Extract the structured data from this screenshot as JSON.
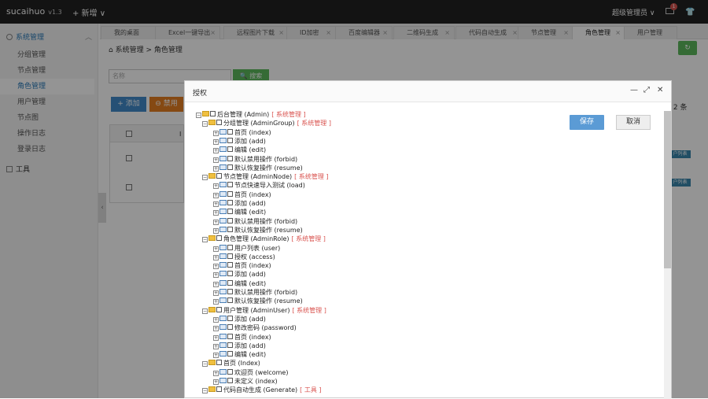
{
  "header": {
    "brand": "sucaihuo",
    "version": "v1.3",
    "new_label": "+ 新增 ∨",
    "admin_label": "超级管理员 ∨",
    "mail_count": "1"
  },
  "sidebar": {
    "group1": "系统管理",
    "items": [
      "分组管理",
      "节点管理",
      "角色管理",
      "用户管理",
      "节点图",
      "操作日志",
      "登录日志"
    ],
    "group2": "工具"
  },
  "tabs": [
    "我的桌面",
    "Excel一键导出",
    "远程图片下载",
    "ID加密",
    "百度编辑器",
    "二维码生成",
    "代码自动生成",
    "节点管理",
    "角色管理",
    "用户管理"
  ],
  "breadcrumb": {
    "root": "系统管理",
    "sep": ">",
    "current": "角色管理"
  },
  "toolbar": {
    "search_placeholder": "名称",
    "search_label": "搜索",
    "add_label": "+ 添加",
    "disable_label": "⊖ 禁用",
    "count_text": ": 2 条"
  },
  "table": {
    "col_id": "I",
    "row_labels": [
      "户列表",
      "户列表"
    ]
  },
  "modal": {
    "title": "授权",
    "save_label": "保存",
    "cancel_label": "取消"
  },
  "tree": [
    {
      "l": 0,
      "t": "f",
      "text": "后台管理 (Admin)",
      "tag": "[ 系统管理 ]"
    },
    {
      "l": 1,
      "t": "f",
      "text": "分组管理 (AdminGroup)",
      "tag": "[ 系统管理 ]"
    },
    {
      "l": 2,
      "t": "p",
      "text": "首页 (index)"
    },
    {
      "l": 2,
      "t": "p",
      "text": "添加 (add)"
    },
    {
      "l": 2,
      "t": "p",
      "text": "编辑 (edit)"
    },
    {
      "l": 2,
      "t": "p",
      "text": "默认禁用操作 (forbid)"
    },
    {
      "l": 2,
      "t": "p",
      "text": "默认恢复操作 (resume)"
    },
    {
      "l": 1,
      "t": "f",
      "text": "节点管理 (AdminNode)",
      "tag": "[ 系统管理 ]"
    },
    {
      "l": 2,
      "t": "p",
      "text": "节点快速导入测试 (load)"
    },
    {
      "l": 2,
      "t": "p",
      "text": "首页 (index)"
    },
    {
      "l": 2,
      "t": "p",
      "text": "添加 (add)"
    },
    {
      "l": 2,
      "t": "p",
      "text": "编辑 (edit)"
    },
    {
      "l": 2,
      "t": "p",
      "text": "默认禁用操作 (forbid)"
    },
    {
      "l": 2,
      "t": "p",
      "text": "默认恢复操作 (resume)"
    },
    {
      "l": 1,
      "t": "f",
      "text": "角色管理 (AdminRole)",
      "tag": "[ 系统管理 ]"
    },
    {
      "l": 2,
      "t": "p",
      "text": "用户列表 (user)"
    },
    {
      "l": 2,
      "t": "p",
      "text": "授权 (access)"
    },
    {
      "l": 2,
      "t": "p",
      "text": "首页 (index)"
    },
    {
      "l": 2,
      "t": "p",
      "text": "添加 (add)"
    },
    {
      "l": 2,
      "t": "p",
      "text": "编辑 (edit)"
    },
    {
      "l": 2,
      "t": "p",
      "text": "默认禁用操作 (forbid)"
    },
    {
      "l": 2,
      "t": "p",
      "text": "默认恢复操作 (resume)"
    },
    {
      "l": 1,
      "t": "f",
      "text": "用户管理 (AdminUser)",
      "tag": "[ 系统管理 ]"
    },
    {
      "l": 2,
      "t": "p",
      "text": "添加 (add)"
    },
    {
      "l": 2,
      "t": "p",
      "text": "修改密码 (password)"
    },
    {
      "l": 2,
      "t": "p",
      "text": "首页 (index)"
    },
    {
      "l": 2,
      "t": "p",
      "text": "添加 (add)"
    },
    {
      "l": 2,
      "t": "p",
      "text": "编辑 (edit)"
    },
    {
      "l": 1,
      "t": "f",
      "text": "首页 (Index)"
    },
    {
      "l": 2,
      "t": "p",
      "text": "欢迎页 (welcome)"
    },
    {
      "l": 2,
      "t": "p",
      "text": "未定义 (index)"
    },
    {
      "l": 1,
      "t": "f",
      "text": "代码自动生成 (Generate)",
      "tag": "[ 工具 ]"
    }
  ],
  "colors": {
    "accent": "#428bca",
    "save": "#5b9bd5",
    "active_text": "#2a7ab8",
    "tag": "#d9534f",
    "success": "#5cb85c"
  }
}
